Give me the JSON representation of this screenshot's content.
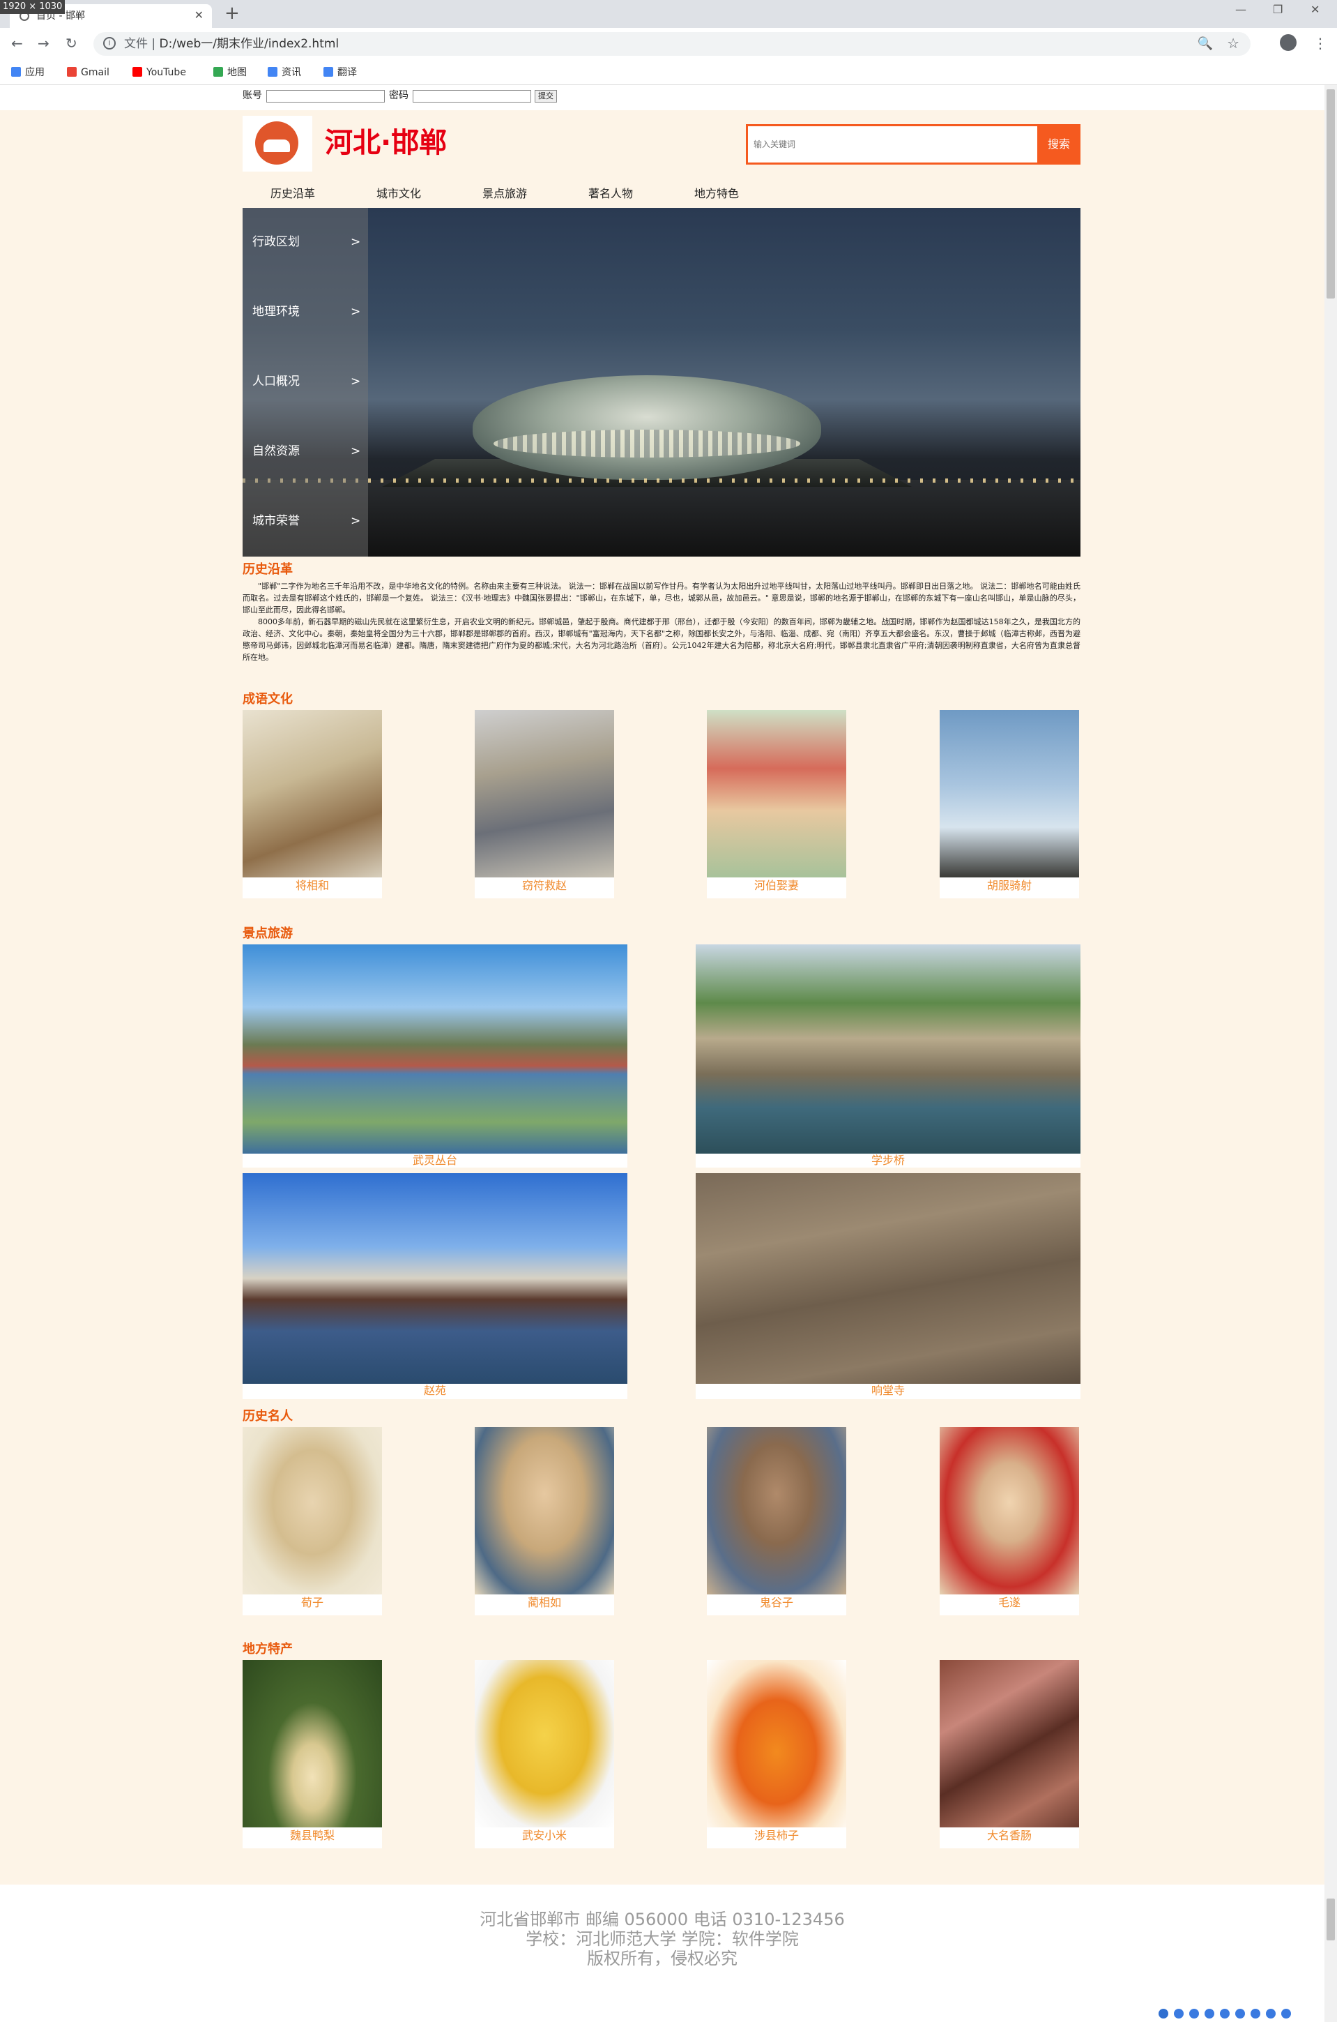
{
  "window": {
    "size_label": "1920 × 1030",
    "tab_title": "首页 - 邯郸",
    "new_tab": "+",
    "minimize": "—",
    "restore": "❐",
    "close": "✕"
  },
  "toolbar": {
    "back": "←",
    "forward": "→",
    "reload": "↻",
    "url_scheme": "文件 |",
    "url_path": "D:/web一/期末作业/index2.html",
    "zoom_icon": "🔍",
    "star": "☆",
    "menu": "⋮"
  },
  "bookmarks": [
    {
      "label": "应用",
      "color": "#4285f4"
    },
    {
      "label": "Gmail",
      "color": "#ea4335"
    },
    {
      "label": "YouTube",
      "color": "#ff0000"
    },
    {
      "label": "地图",
      "color": "#34a853"
    },
    {
      "label": "资讯",
      "color": "#4285f4"
    },
    {
      "label": "翻译",
      "color": "#4285f4"
    }
  ],
  "login": {
    "account_label": "账号",
    "password_label": "密码",
    "submit": "提交"
  },
  "header": {
    "title": "河北·邯郸",
    "search_placeholder": "输入关键词",
    "search_button": "搜索"
  },
  "nav": [
    "历史沿革",
    "城市文化",
    "景点旅游",
    "著名人物",
    "地方特色"
  ],
  "side_menu": [
    {
      "label": "行政区划",
      "arrow": ">"
    },
    {
      "label": "地理环境",
      "arrow": ">"
    },
    {
      "label": "人口概况",
      "arrow": ">"
    },
    {
      "label": "自然资源",
      "arrow": ">"
    },
    {
      "label": "城市荣誉",
      "arrow": ">"
    }
  ],
  "history": {
    "title": "历史沿革",
    "para1": "\"邯郸\"二字作为地名三千年沿用不改，是中华地名文化的特例。名称由来主要有三种说法。 说法一：邯郸在战国以前写作甘丹。有学者认为太阳出升过地平线叫甘，太阳落山过地平线叫丹。邯郸即日出日落之地。 说法二：邯郸地名可能由姓氏而取名。过去是有邯郸这个姓氏的，邯郸是一个复姓。 说法三：《汉书·地理志》中魏国张晏提出：\"邯郸山，在东城下，单，尽也，城郭从邑，故加邑云。\" 意思是说，邯郸的地名源于邯郸山，在邯郸的东城下有一座山名叫邯山，单是山脉的尽头，邯山至此而尽，因此得名邯郸。",
    "para2": "8000多年前，新石器早期的磁山先民就在这里繁衍生息，开启农业文明的新纪元。邯郸城邑，肇起于殷商。商代建都于邢（邢台），迁都于殷（今安阳）的数百年间，邯郸为畿辅之地。战国时期，邯郸作为赵国都城达158年之久，是我国北方的政治、经济、文化中心。秦朝，秦始皇将全国分为三十六郡，邯郸郡是邯郸郡的首府。西汉，邯郸城有\"富冠海内，天下名都\"之称，除国都长安之外，与洛阳、临淄、成都、宛（南阳）齐享五大都会盛名。东汉，曹操于邺城（临漳古称邺，西晋为避愍帝司马邺讳，因邺城北临漳河而易名临漳）建都。隋唐，隋末窦建德把广府作为夏的都城;宋代，大名为河北路治所（首府）。公元1042年建大名为陪都，称北京大名府;明代，邯郸县隶北直隶省广平府;清朝因袭明制称直隶省，大名府曾为直隶总督所在地。"
  },
  "idioms": {
    "title": "成语文化",
    "items": [
      "将相和",
      "窃符救赵",
      "河伯娶妻",
      "胡服骑射"
    ]
  },
  "scenic": {
    "title": "景点旅游",
    "items": [
      "武灵丛台",
      "学步桥",
      "赵苑",
      "响堂寺"
    ]
  },
  "people": {
    "title": "历史名人",
    "items": [
      "荀子",
      "蔺相如",
      "鬼谷子",
      "毛遂"
    ]
  },
  "specialty": {
    "title": "地方特产",
    "items": [
      "魏县鸭梨",
      "武安小米",
      "涉县柿子",
      "大名香肠"
    ]
  },
  "footer": {
    "line1": "河北省邯郸市 邮编 056000 电话 0310-123456",
    "line2": "学校：河北师范大学 学院：软件学院",
    "line3": "版权所有，侵权必究"
  },
  "colors": {
    "accent": "#e8590c",
    "title_red": "#e60012",
    "caption": "#f08a2c",
    "page_bg": "#fdf4e7"
  }
}
